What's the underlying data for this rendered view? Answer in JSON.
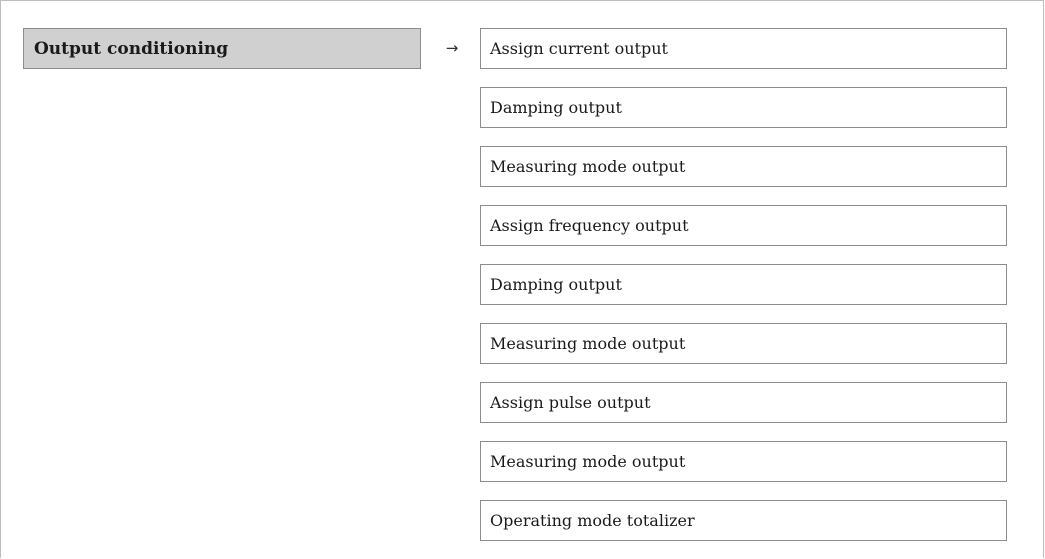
{
  "menu": {
    "group_label": "Output conditioning",
    "arrow_glyph": "→",
    "parameters": [
      "Assign current output",
      "Damping output",
      "Measuring mode output",
      "Assign frequency output",
      "Damping output",
      "Measuring mode output",
      "Assign pulse output",
      "Measuring mode output",
      "Operating mode totalizer"
    ]
  }
}
